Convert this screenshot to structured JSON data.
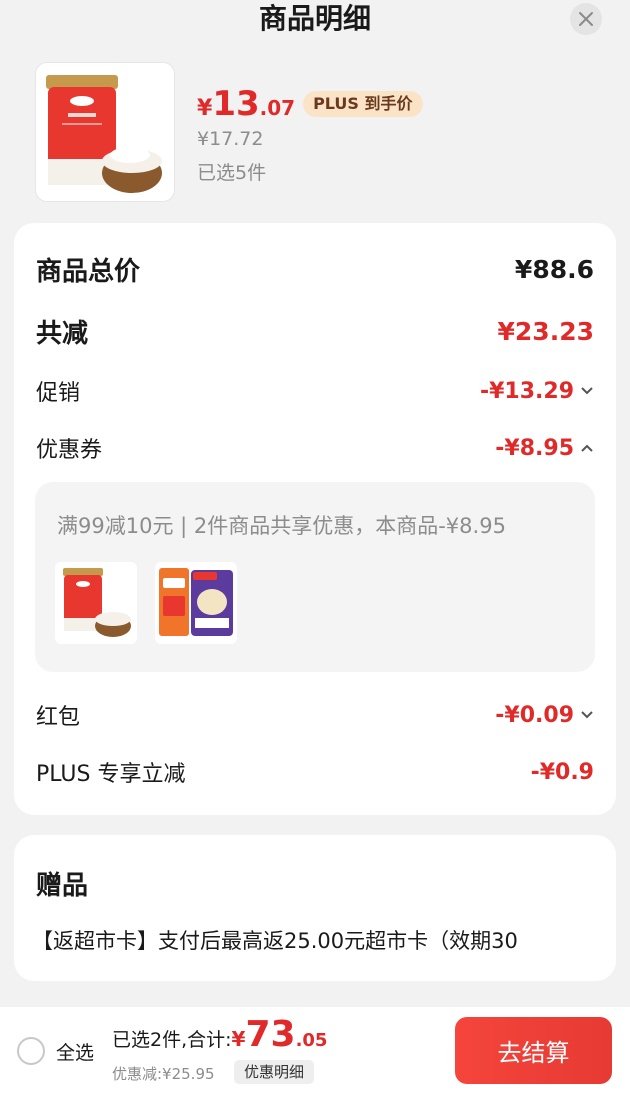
{
  "header": {
    "title": "商品明细",
    "close_icon": "close-icon"
  },
  "product": {
    "price_symbol": "¥",
    "price_int": "13",
    "price_dec": ".07",
    "plus_badge": "PLUS 到手价",
    "original_price": "¥17.72",
    "selected": "已选5件"
  },
  "summary": {
    "total_label": "商品总价",
    "total_value": "¥88.6",
    "reduce_label": "共减",
    "reduce_value": "¥23.23",
    "promo_label": "促销",
    "promo_value": "-¥13.29",
    "coupon_label": "优惠券",
    "coupon_value": "-¥8.95",
    "coupon_detail": "满99减10元 | 2件商品共享优惠，本商品-¥8.95",
    "redpacket_label": "红包",
    "redpacket_value": "-¥0.09",
    "plus_label": "PLUS 专享立减",
    "plus_value": "-¥0.9"
  },
  "gift": {
    "title": "赠品",
    "desc": "【返超市卡】支付后最高返25.00元超市卡（效期30"
  },
  "bottom": {
    "select_all": "全选",
    "total_label": "已选2件,合计:",
    "total_symbol": "¥",
    "total_int": "73",
    "total_dec": ".05",
    "discount": "优惠减:¥25.95",
    "detail_button": "优惠明细",
    "checkout_button": "去结算"
  },
  "colors": {
    "accent_red": "#e02a2a",
    "plus_badge_bg": "#fbe3c8",
    "checkout_bg": "#f5453c"
  }
}
